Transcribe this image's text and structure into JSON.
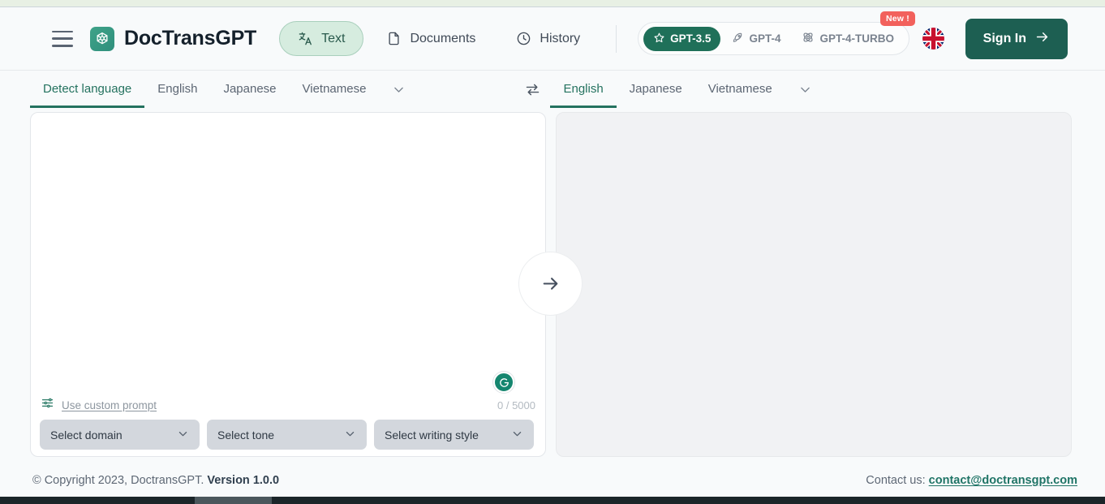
{
  "app": {
    "brand": "DocTransGPT",
    "logo_icon": "doctransgpt-logo-icon",
    "menu_icon": "hamburger-menu-icon"
  },
  "nav": {
    "items": [
      {
        "label": "Text",
        "icon": "translate-icon",
        "active": true
      },
      {
        "label": "Documents",
        "icon": "document-icon",
        "active": false
      },
      {
        "label": "History",
        "icon": "clock-icon",
        "active": false
      }
    ]
  },
  "models": {
    "items": [
      {
        "label": "GPT-3.5",
        "icon": "star-icon",
        "active": true
      },
      {
        "label": "GPT-4",
        "icon": "rocket-icon",
        "active": false
      },
      {
        "label": "GPT-4-TURBO",
        "icon": "atom-icon",
        "active": false
      }
    ],
    "badge": "New !"
  },
  "account": {
    "flag_icon": "uk-flag-icon",
    "signin_label": "Sign In",
    "signin_arrow_icon": "arrow-right-icon"
  },
  "source_languages": {
    "tabs": [
      {
        "label": "Detect language",
        "active": true
      },
      {
        "label": "English",
        "active": false
      },
      {
        "label": "Japanese",
        "active": false
      },
      {
        "label": "Vietnamese",
        "active": false
      }
    ],
    "more_icon": "chevron-down-icon"
  },
  "swap": {
    "icon": "swap-languages-icon"
  },
  "target_languages": {
    "tabs": [
      {
        "label": "English",
        "active": true
      },
      {
        "label": "Japanese",
        "active": false
      },
      {
        "label": "Vietnamese",
        "active": false
      }
    ],
    "more_icon": "chevron-down-icon"
  },
  "editor": {
    "source_value": "",
    "source_placeholder": "",
    "target_value": "",
    "target_placeholder": "",
    "counter": "0 / 5000",
    "custom_prompt_label": "Use custom prompt",
    "custom_prompt_icon": "sliders-icon",
    "grammarly_icon": "grammarly-icon",
    "translate_icon": "arrow-right-icon"
  },
  "options": [
    {
      "label": "Select domain",
      "icon": "chevron-down-icon"
    },
    {
      "label": "Select tone",
      "icon": "chevron-down-icon"
    },
    {
      "label": "Select writing style",
      "icon": "chevron-down-icon"
    }
  ],
  "footer": {
    "copyright": "© Copyright 2023, DoctransGPT.",
    "version": "Version 1.0.0",
    "contact_label": "Contact us:",
    "contact_email": "contact@doctransgpt.com"
  },
  "colors": {
    "brand_green": "#1f7059",
    "accent_teal": "#24725f",
    "badge_red": "#f2615c",
    "pill_bg": "#d6ecdf",
    "panel_gray": "#f1f2f4"
  }
}
